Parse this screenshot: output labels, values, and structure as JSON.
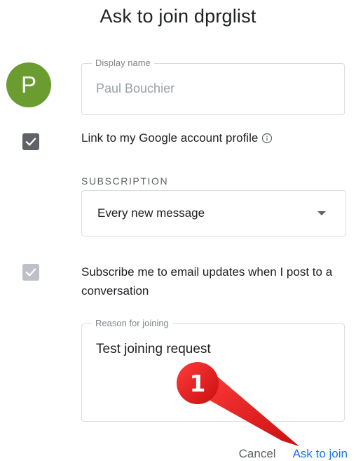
{
  "dialog": {
    "title": "Ask to join dprglist"
  },
  "avatar": {
    "initial": "P",
    "color": "#6a9c2f"
  },
  "display_name": {
    "label": "Display name",
    "value": "Paul Bouchier"
  },
  "link_profile": {
    "checked": true,
    "label": "Link to my Google account profile",
    "icon": "info-icon"
  },
  "subscription": {
    "section_label": "SUBSCRIPTION",
    "selected": "Every new message"
  },
  "email_updates": {
    "checked": true,
    "disabled": true,
    "label": "Subscribe me to email updates when I post to a conversation"
  },
  "reason": {
    "label": "Reason for joining",
    "value": "Test joining request"
  },
  "actions": {
    "cancel": "Cancel",
    "submit": "Ask to join"
  },
  "annotation": {
    "number": "1",
    "color": "#e31b1b"
  },
  "colors": {
    "primary": "#1a73e8",
    "text": "#202124",
    "muted": "#5f6368"
  }
}
